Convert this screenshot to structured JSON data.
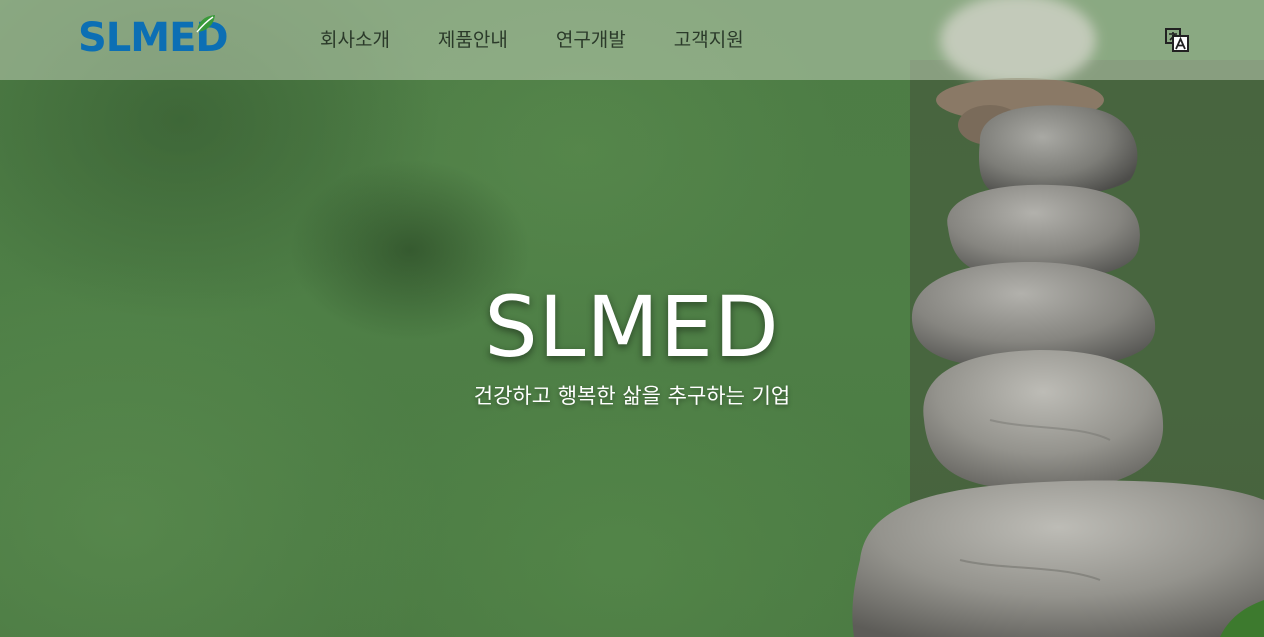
{
  "header": {
    "logo_text": "SLMED",
    "nav": [
      "회사소개",
      "제품안내",
      "연구개발",
      "고객지원"
    ],
    "language_icon": "translate-icon"
  },
  "hero": {
    "title": "SLMED",
    "subtitle": "건강하고 행복한 삶을 추구하는 기업",
    "image": "stacked-stones-cairn"
  },
  "colors": {
    "brand_blue": "#0c6fb4",
    "leaf_green": "#3a9a3a",
    "hero_green": "#4e7f46"
  }
}
